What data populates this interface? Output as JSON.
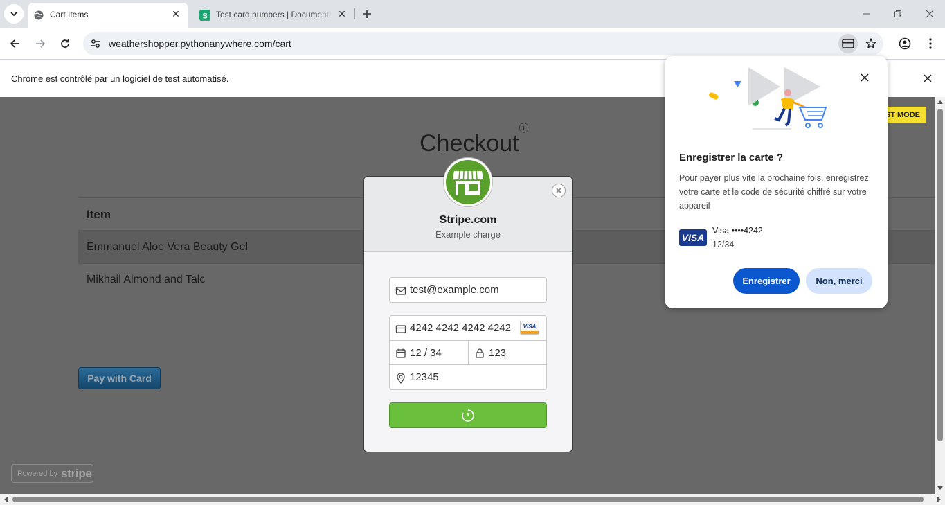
{
  "browser": {
    "tabs": [
      {
        "title": "Cart Items",
        "active": true
      },
      {
        "title": "Test card numbers | Documentation",
        "active": false
      }
    ],
    "url": "weathershopper.pythonanywhere.com/cart",
    "infobar_message": "Chrome est contrôlé par un logiciel de test automatisé."
  },
  "page": {
    "title": "Checkout",
    "title_sup": "ⓘ",
    "table_header": "Item",
    "rows": [
      "Emmanuel Aloe Vera Beauty Gel",
      "Mikhail Almond and Talc"
    ],
    "pay_button": "Pay with Card",
    "test_mode_badge": "ST MODE",
    "powered_by": "Powered by",
    "powered_brand": "stripe"
  },
  "stripe_modal": {
    "merchant": "Stripe.com",
    "description": "Example charge",
    "email": "test@example.com",
    "card_number": "4242 4242 4242 4242",
    "card_brand": "VISA",
    "expiry": "12 / 34",
    "cvc": "123",
    "zip": "12345"
  },
  "save_card_bubble": {
    "title": "Enregistrer la carte ?",
    "body": "Pour payer plus vite la prochaine fois, enregistrez votre carte et le code de sécurité chiffré sur votre appareil",
    "card_brand": "VISA",
    "card_label": "Visa  ••••4242",
    "card_expiry": "12/34",
    "save_button": "Enregistrer",
    "decline_button": "Non, merci"
  },
  "colors": {
    "accent_blue": "#0b57d0",
    "stripe_green": "#6abf3c",
    "test_mode_yellow": "#f4df2e"
  }
}
